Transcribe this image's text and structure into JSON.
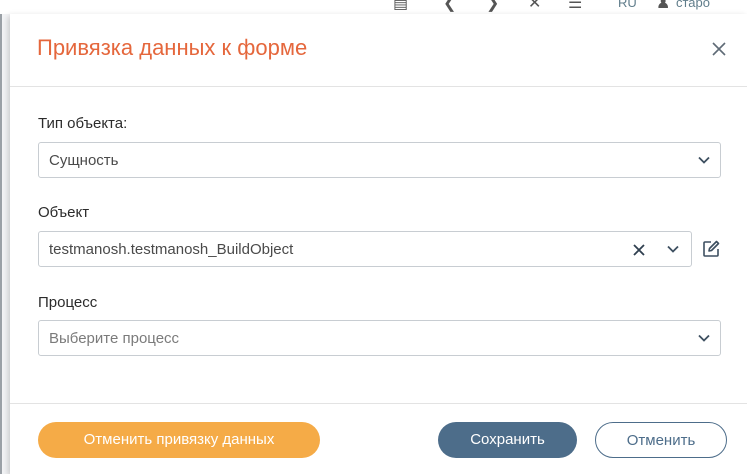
{
  "background": {
    "glyphs": [
      "save-icon",
      "undo-icon",
      "redo-icon",
      "close-icon",
      "list-icon"
    ],
    "lang": "RU",
    "user_text": "старо"
  },
  "modal": {
    "title": "Привязка данных к форме",
    "fields": {
      "object_type": {
        "label": "Тип объекта:",
        "value": "Сущность"
      },
      "object": {
        "label": "Объект",
        "value": "testmanosh.testmanosh_BuildObject"
      },
      "process": {
        "label": "Процесс",
        "placeholder": "Выберите процесс"
      }
    },
    "buttons": {
      "unbind": "Отменить привязку данных",
      "save": "Сохранить",
      "cancel": "Отменить"
    }
  },
  "colors": {
    "title": "#e5673c",
    "unbind_button": "#f5ab47",
    "save_button": "#4d6d8a"
  }
}
